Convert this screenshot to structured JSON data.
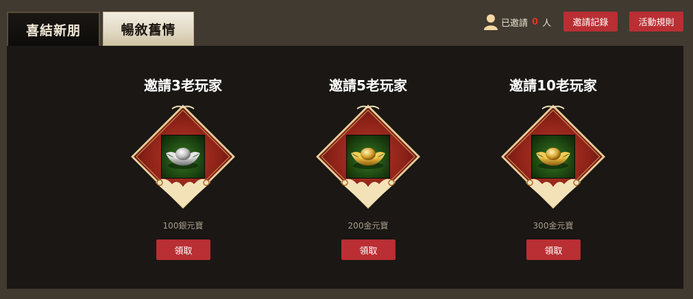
{
  "tabs": [
    {
      "label": "喜結新朋",
      "active": true
    },
    {
      "label": "暢敘舊情",
      "active": false
    }
  ],
  "header": {
    "user_icon": "user-icon",
    "invited_prefix": "已邀請",
    "invited_count": "0",
    "invited_suffix": "人",
    "records_button": "邀請記錄",
    "rules_button": "活動規則"
  },
  "rewards": [
    {
      "title": "邀請3老玩家",
      "item": "silver-ingot-icon",
      "label": "100銀元寶",
      "button": "領取"
    },
    {
      "title": "邀請5老玩家",
      "item": "gold-ingot-icon",
      "label": "200金元寶",
      "button": "領取"
    },
    {
      "title": "邀請10老玩家",
      "item": "gold-ingot-icon",
      "label": "300金元寶",
      "button": "領取"
    }
  ],
  "colors": {
    "page_background": "#413a31",
    "panel_background": "#1a1714",
    "button_red": "#b92f33",
    "count_red": "#e8302b",
    "frame_red": "#a0271d",
    "frame_gold": "#e6cf9a"
  }
}
